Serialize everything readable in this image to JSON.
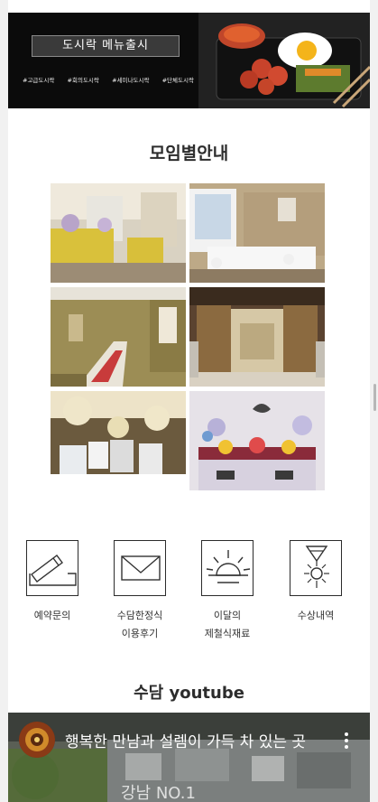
{
  "banner": {
    "title": "도시락 메뉴출시",
    "tags": [
      "#고급도시락",
      "#회의도시락",
      "#세미나도시락",
      "#단체도시락"
    ]
  },
  "gathering": {
    "heading": "모임별안내"
  },
  "menu": {
    "items": [
      {
        "label": "예약문의",
        "icon": "pencil-icon"
      },
      {
        "label": "수담한정식\n이용후기",
        "icon": "envelope-icon"
      },
      {
        "label": "이달의\n제철식재료",
        "icon": "sunrise-icon"
      },
      {
        "label": "수상내역",
        "icon": "medal-icon"
      }
    ]
  },
  "youtube": {
    "heading": "수담 youtube",
    "video_title": "행복한 만남과 설렘이 가득 차 있는 곳"
  },
  "colors": {
    "heading": "#2c2c2c",
    "banner_bg": "#0b0b0b",
    "page_bg": "#ffffff",
    "outer_bg": "#f1f1f1"
  }
}
